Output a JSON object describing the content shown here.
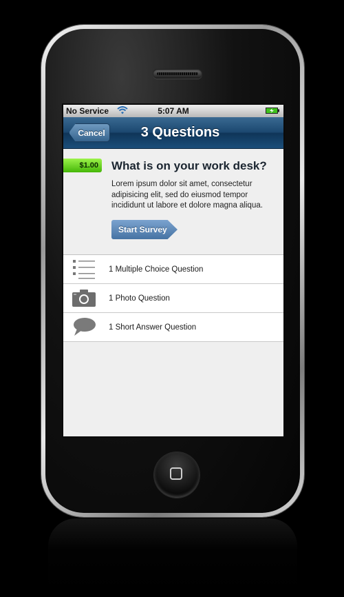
{
  "status_bar": {
    "carrier": "No Service",
    "time": "5:07 AM"
  },
  "nav": {
    "cancel_label": "Cancel",
    "title": "3 Questions"
  },
  "survey": {
    "price": "$1.00",
    "title": "What is on your work desk?",
    "description": "Lorem ipsum dolor sit amet, consectetur adipisicing elit, sed do eiusmod tempor incididunt ut labore et dolore magna aliqua.",
    "start_label": "Start Survey"
  },
  "questions": [
    {
      "icon": "list-icon",
      "label": "1 Multiple Choice Question"
    },
    {
      "icon": "camera-icon",
      "label": "1 Photo Question"
    },
    {
      "icon": "speech-bubble-icon",
      "label": "1 Short Answer Question"
    }
  ],
  "colors": {
    "nav_bar": "#1c4870",
    "price_badge": "#45b608",
    "start_button": "#4673a3"
  }
}
